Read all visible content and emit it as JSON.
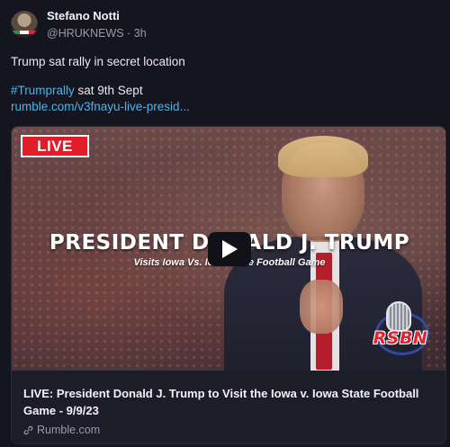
{
  "post": {
    "author": {
      "name": "Stefano Notti",
      "handle": "@HRUKNEWS",
      "separator": "·",
      "time": "3h"
    },
    "text": {
      "line1": "Trump sat rally in secret location",
      "hashtag": "#Trumprally",
      "line2_rest": " sat 9th Sept",
      "url": "rumble.com/v3fnayu-live-presid..."
    },
    "card": {
      "badge": "LIVE",
      "headline": "PRESIDENT DONALD J. TRUMP",
      "subhead": "Visits Iowa Vs. Iowa State Football Game",
      "logo": "RSBN",
      "title": "LIVE: President Donald J. Trump to Visit the Iowa v. Iowa State Football Game - 9/9/23",
      "domain": "Rumble.com"
    }
  },
  "icons": {
    "play": "play-icon",
    "link": "link-icon"
  },
  "colors": {
    "background": "#15151f",
    "link": "#4fb4ea",
    "live_badge": "#e11d2a",
    "muted_text": "#9a9aac"
  }
}
